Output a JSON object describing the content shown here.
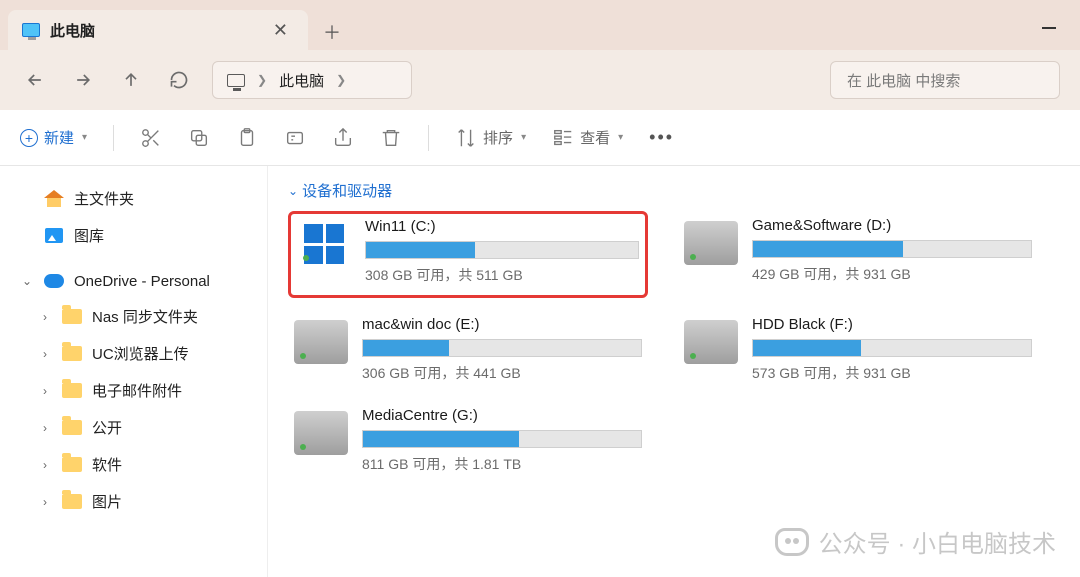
{
  "tab": {
    "title": "此电脑"
  },
  "breadcrumb": {
    "location": "此电脑"
  },
  "search": {
    "placeholder": "在 此电脑 中搜索"
  },
  "toolbar": {
    "new_label": "新建",
    "sort_label": "排序",
    "view_label": "查看"
  },
  "sidebar": {
    "home": "主文件夹",
    "gallery": "图库",
    "onedrive": "OneDrive - Personal",
    "items": [
      "Nas 同步文件夹",
      "UC浏览器上传",
      "电子邮件附件",
      "公开",
      "软件",
      "图片"
    ]
  },
  "section": {
    "header": "设备和驱动器"
  },
  "drives": [
    {
      "name": "Win11 (C:)",
      "free": "308 GB 可用，共 511 GB",
      "fill": 40,
      "os": true,
      "highlight": true
    },
    {
      "name": "Game&Software (D:)",
      "free": "429 GB 可用，共 931 GB",
      "fill": 54
    },
    {
      "name": "mac&win doc (E:)",
      "free": "306 GB 可用，共 441 GB",
      "fill": 31
    },
    {
      "name": "HDD Black (F:)",
      "free": "573 GB 可用，共 931 GB",
      "fill": 39
    },
    {
      "name": "MediaCentre (G:)",
      "free": "811 GB 可用，共 1.81 TB",
      "fill": 56
    }
  ],
  "watermark": "公众号 · 小白电脑技术"
}
